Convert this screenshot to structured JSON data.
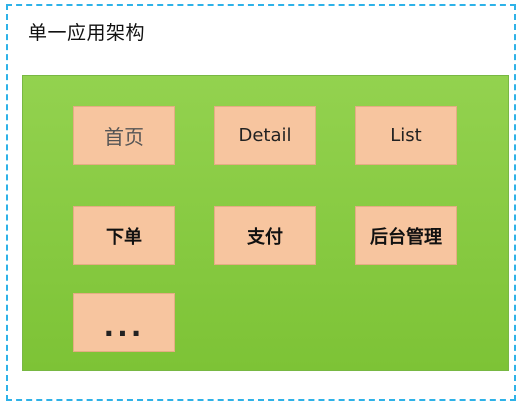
{
  "diagram": {
    "title": "单一应用架构",
    "modules": [
      {
        "label": "首页"
      },
      {
        "label": "Detail"
      },
      {
        "label": "List"
      },
      {
        "label": "下单"
      },
      {
        "label": "支付"
      },
      {
        "label": "后台管理"
      },
      {
        "label": "..."
      }
    ]
  },
  "colors": {
    "frame_border": "#2eb2e8",
    "container_fill": "#8ccc45",
    "module_fill": "#f7c59f"
  }
}
